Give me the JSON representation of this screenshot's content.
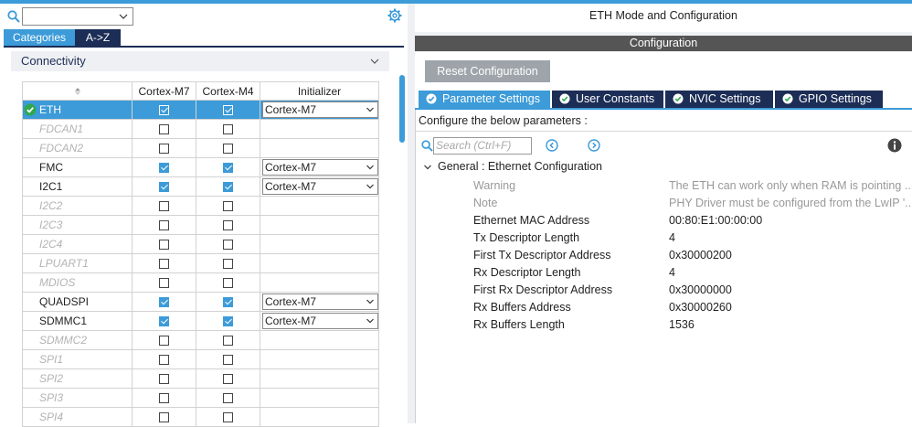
{
  "left": {
    "search": {
      "value": ""
    },
    "tabs": {
      "categories": "Categories",
      "az": "A->Z"
    },
    "category": "Connectivity",
    "table": {
      "headers": {
        "sort": "",
        "m7": "Cortex-M7",
        "m4": "Cortex-M4",
        "init": "Initializer"
      },
      "rows": [
        {
          "name": "ETH",
          "m7": true,
          "m4": true,
          "init": "Cortex-M7",
          "enabled": true,
          "selected": true,
          "ok": true
        },
        {
          "name": "FDCAN1",
          "m7": false,
          "m4": false,
          "init": "",
          "enabled": false
        },
        {
          "name": "FDCAN2",
          "m7": false,
          "m4": false,
          "init": "",
          "enabled": false
        },
        {
          "name": "FMC",
          "m7": true,
          "m4": true,
          "init": "Cortex-M7",
          "enabled": true
        },
        {
          "name": "I2C1",
          "m7": true,
          "m4": true,
          "init": "Cortex-M7",
          "enabled": true
        },
        {
          "name": "I2C2",
          "m7": false,
          "m4": false,
          "init": "",
          "enabled": false
        },
        {
          "name": "I2C3",
          "m7": false,
          "m4": false,
          "init": "",
          "enabled": false
        },
        {
          "name": "I2C4",
          "m7": false,
          "m4": false,
          "init": "",
          "enabled": false
        },
        {
          "name": "LPUART1",
          "m7": false,
          "m4": false,
          "init": "",
          "enabled": false
        },
        {
          "name": "MDIOS",
          "m7": false,
          "m4": false,
          "init": "",
          "enabled": false
        },
        {
          "name": "QUADSPI",
          "m7": true,
          "m4": true,
          "init": "Cortex-M7",
          "enabled": true
        },
        {
          "name": "SDMMC1",
          "m7": true,
          "m4": true,
          "init": "Cortex-M7",
          "enabled": true
        },
        {
          "name": "SDMMC2",
          "m7": false,
          "m4": false,
          "init": "",
          "enabled": false
        },
        {
          "name": "SPI1",
          "m7": false,
          "m4": false,
          "init": "",
          "enabled": false
        },
        {
          "name": "SPI2",
          "m7": false,
          "m4": false,
          "init": "",
          "enabled": false
        },
        {
          "name": "SPI3",
          "m7": false,
          "m4": false,
          "init": "",
          "enabled": false
        },
        {
          "name": "SPI4",
          "m7": false,
          "m4": false,
          "init": "",
          "enabled": false
        }
      ]
    }
  },
  "right": {
    "title": "ETH Mode and Configuration",
    "config_bar": "Configuration",
    "reset_label": "Reset Configuration",
    "tabs": [
      "Parameter Settings",
      "User Constants",
      "NVIC Settings",
      "GPIO Settings"
    ],
    "hint": "Configure the below parameters :",
    "search_placeholder": "Search (Ctrl+F)",
    "group_label": "General : Ethernet Configuration",
    "params": [
      {
        "key": "Warning",
        "value": "The ETH can work only when RAM is pointing ...",
        "muted": true
      },
      {
        "key": "Note",
        "value": "PHY Driver must be configured from the LwIP '...",
        "muted": true
      },
      {
        "key": "Ethernet MAC Address",
        "value": "00:80:E1:00:00:00"
      },
      {
        "key": "Tx Descriptor Length",
        "value": "4"
      },
      {
        "key": "First Tx Descriptor Address",
        "value": "0x30000200"
      },
      {
        "key": "Rx Descriptor Length",
        "value": "4"
      },
      {
        "key": "First Rx Descriptor Address",
        "value": "0x30000000"
      },
      {
        "key": "Rx Buffers Address",
        "value": "0x30000260"
      },
      {
        "key": "Rx Buffers Length",
        "value": "1536"
      }
    ]
  },
  "colors": {
    "accent": "#3c9bd8",
    "navy": "#1c2d56",
    "ok": "#2fa84f",
    "dim_text": "#b3b3b3"
  },
  "icons": [
    "search-icon",
    "chevron-down-icon",
    "gear-icon",
    "check-circle-icon",
    "sort-icon",
    "chevron-left-icon",
    "chevron-right-icon",
    "info-icon"
  ]
}
